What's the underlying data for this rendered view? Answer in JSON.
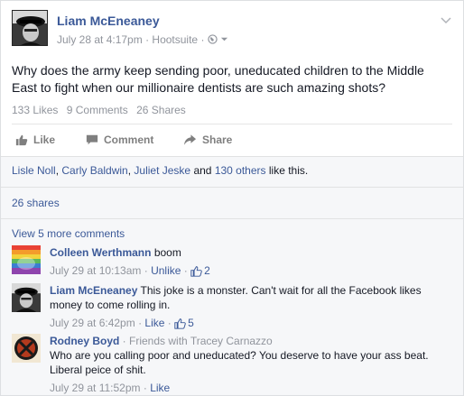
{
  "post": {
    "author": "Liam McEneaney",
    "date": "July 28 at 4:17pm",
    "via": "Hootsuite",
    "meta_sep": " · ",
    "text": "Why does the army keep sending poor, uneducated children to the Middle East to fight when our millionaire dentists are such amazing shots?",
    "stats": {
      "likes": "133 Likes",
      "comments": "9 Comments",
      "shares": "26 Shares"
    },
    "actions": {
      "like": "Like",
      "comment": "Comment",
      "share": "Share"
    }
  },
  "likes_summary": {
    "name1": "Lisle Noll",
    "name2": "Carly Baldwin",
    "name3": "Juliet Jeske",
    "and": "and",
    "others": "130 others",
    "suffix": "like this."
  },
  "shares_link": "26 shares",
  "view_more": "View 5 more comments",
  "comments": [
    {
      "name": "Colleen Werthmann",
      "text": "boom",
      "date": "July 29 at 10:13am",
      "action": "Unlike",
      "likes": "2"
    },
    {
      "name": "Liam McEneaney",
      "text": "This joke is a monster. Can't wait for all the Facebook likes money to come rolling in.",
      "date": "July 29 at 6:42pm",
      "action": "Like",
      "likes": "5"
    },
    {
      "name": "Rodney Boyd",
      "context": " · Friends with Tracey Carnazzo",
      "text": "Who are you calling poor and uneducated? You deserve to have your ass beat. Liberal peice of shit.",
      "date": "July 29 at 11:52pm",
      "action": "Like"
    }
  ],
  "colors": {
    "link": "#3b5998",
    "muted": "#90949c",
    "text": "#141823"
  },
  "icons": [
    "globe-icon",
    "dropdown-caret-icon",
    "chevron-down-icon",
    "thumbs-up-icon",
    "comment-icon",
    "share-arrow-icon"
  ]
}
